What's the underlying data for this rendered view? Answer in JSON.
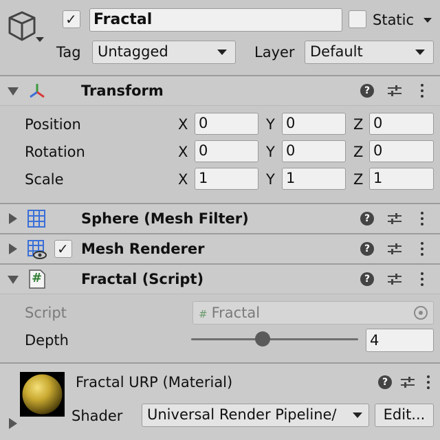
{
  "object": {
    "name": "Fractal",
    "active": true,
    "static_label": "Static",
    "tag_label": "Tag",
    "tag_value": "Untagged",
    "layer_label": "Layer",
    "layer_value": "Default"
  },
  "transform": {
    "title": "Transform",
    "rows": [
      {
        "label": "Position",
        "x": "0",
        "y": "0",
        "z": "0"
      },
      {
        "label": "Rotation",
        "x": "0",
        "y": "0",
        "z": "0"
      },
      {
        "label": "Scale",
        "x": "1",
        "y": "1",
        "z": "1"
      }
    ],
    "axis_x": "X",
    "axis_y": "Y",
    "axis_z": "Z"
  },
  "mesh_filter": {
    "title": "Sphere (Mesh Filter)"
  },
  "mesh_renderer": {
    "title": "Mesh Renderer",
    "enabled": true
  },
  "script_component": {
    "title": "Fractal (Script)",
    "script_label": "Script",
    "script_value": "Fractal",
    "depth_label": "Depth",
    "depth_value": "4",
    "depth_fraction": 0.43
  },
  "material": {
    "title": "Fractal URP (Material)",
    "shader_label": "Shader",
    "shader_value": "Universal Render Pipeline/",
    "edit_label": "Edit..."
  },
  "icons": {
    "help": "?",
    "script_hash": "#",
    "check": "✓"
  },
  "colors": {
    "background": "#c8c8c8",
    "field": "#f0f0f0",
    "sphere": "#c8a830"
  }
}
